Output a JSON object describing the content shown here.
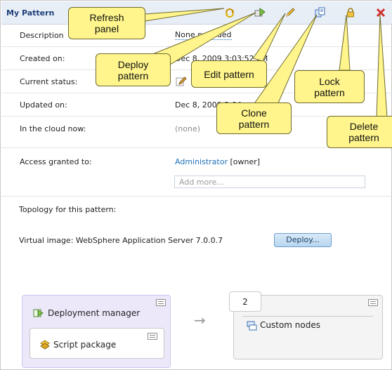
{
  "panel": {
    "title": "My Pattern"
  },
  "fields": {
    "description": {
      "label": "Description",
      "value": "None provided"
    },
    "created_on": {
      "label": "Created on:",
      "value": "Dec 8, 2009 3:03:52 PM"
    },
    "current_status": {
      "label": "Current status:"
    },
    "updated_on": {
      "label": "Updated on:",
      "value": "Dec 8, 2009 3:04"
    },
    "in_cloud": {
      "label": "In the cloud now:",
      "value": "(none)"
    },
    "access_granted": {
      "label": "Access granted to:",
      "user": "Administrator",
      "role": "[owner]",
      "add_placeholder": "Add more..."
    }
  },
  "topology": {
    "label": "Topology for this pattern:",
    "virtual_image": "Virtual image: WebSphere Application Server 7.0.0.7",
    "deploy_label": "Deploy..."
  },
  "diagram": {
    "deployment_manager": "Deployment manager",
    "script_package": "Script package",
    "custom_nodes_count": "2",
    "custom_nodes": "Custom nodes",
    "arrow": "→"
  },
  "toolbar": {
    "refresh_icon": "refresh-icon",
    "deploy_icon": "deploy-icon",
    "edit_icon": "pencil-icon",
    "clone_icon": "clone-icon",
    "lock_icon": "lock-icon",
    "delete_icon": "close-icon"
  },
  "callouts": {
    "refresh": "Refresh\npanel",
    "deploy": "Deploy\npattern",
    "edit": "Edit pattern",
    "clone": "Clone\npattern",
    "lock": "Lock\npattern",
    "delete": "Delete\npattern"
  },
  "colors": {
    "callout_fill": "#fff58c",
    "header_fill": "#e8eef6",
    "link": "#1d6fb8",
    "delete_red": "#d0312d",
    "lavender_box": "#ede7fa"
  }
}
